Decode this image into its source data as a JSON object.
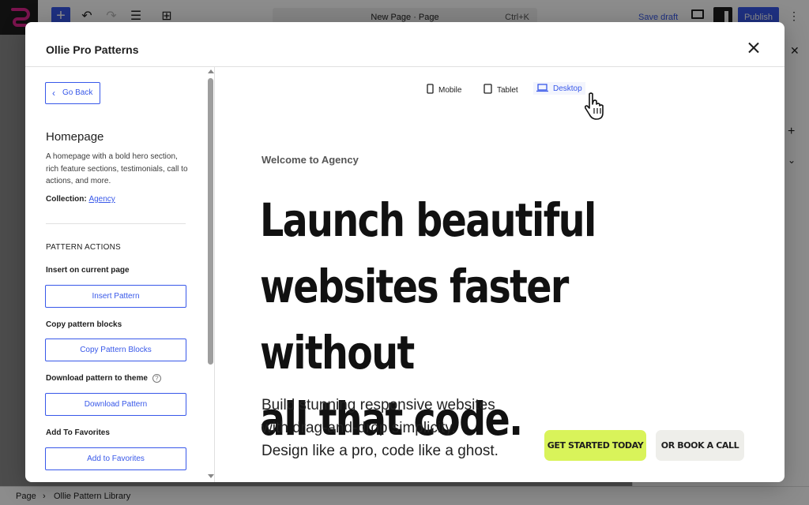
{
  "editor": {
    "document_title": "New Page · Page",
    "shortcut": "Ctrl+K",
    "save_draft": "Save draft",
    "publish": "Publish",
    "more_icon": "⋮"
  },
  "footer": {
    "breadcrumb": [
      "Page",
      "Ollie Pattern Library"
    ],
    "separator": "›"
  },
  "modal": {
    "title": "Ollie Pro Patterns",
    "close_icon": "close-icon"
  },
  "sidebar": {
    "go_back": "Go Back",
    "pattern_name": "Homepage",
    "pattern_description": "A homepage with a bold hero section, rich feature sections, testimonials, call to actions, and more.",
    "collection_label": "Collection:",
    "collection_value": "Agency",
    "section_heading": "PATTERN ACTIONS",
    "actions": [
      {
        "label": "Insert on current page",
        "button": "Insert Pattern"
      },
      {
        "label": "Copy pattern blocks",
        "button": "Copy Pattern Blocks"
      },
      {
        "label": "Download pattern to theme",
        "button": "Download Pattern"
      },
      {
        "label": "Add To Favorites",
        "button": "Add to Favorites"
      }
    ]
  },
  "preview": {
    "devices": [
      {
        "label": "Mobile",
        "icon": "mobile-icon"
      },
      {
        "label": "Tablet",
        "icon": "tablet-icon"
      },
      {
        "label": "Desktop",
        "icon": "desktop-icon",
        "active": true
      }
    ],
    "eyebrow": "Welcome to Agency",
    "headline_lines": [
      "Launch beautiful",
      "websites faster without",
      "all that code."
    ],
    "body_lines": [
      "Build stunning responsive websites",
      "with drag-and-drop simplicity.",
      "Design like a pro, code like a ghost."
    ],
    "cta_primary": "GET STARTED TODAY",
    "cta_secondary": "OR BOOK A CALL",
    "accent_color": "#d9f35a",
    "link_color": "#3858e9"
  }
}
